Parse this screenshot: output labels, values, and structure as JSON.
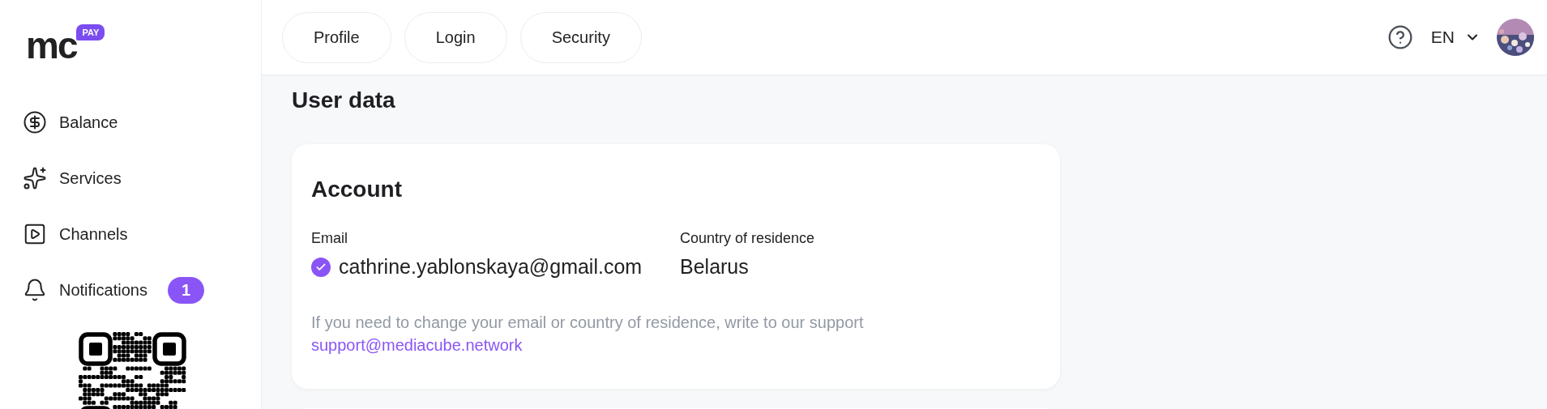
{
  "logo": {
    "text": "mc",
    "badge": "PAY"
  },
  "sidebar": {
    "items": [
      {
        "label": "Balance"
      },
      {
        "label": "Services"
      },
      {
        "label": "Channels"
      },
      {
        "label": "Notifications",
        "badge": "1"
      }
    ]
  },
  "tabs": [
    {
      "label": "Profile"
    },
    {
      "label": "Login"
    },
    {
      "label": "Security"
    }
  ],
  "header": {
    "language": "EN"
  },
  "page_title": "User data",
  "account_card": {
    "title": "Account",
    "fields": [
      {
        "label": "Email",
        "value": "cathrine.yablonskaya@gmail.com",
        "verified": true
      },
      {
        "label": "Country of residence",
        "value": "Belarus",
        "verified": false
      }
    ],
    "note": "If you need to change your email or country of residence, write to our support",
    "support_link": "support@mediacube.network"
  }
}
